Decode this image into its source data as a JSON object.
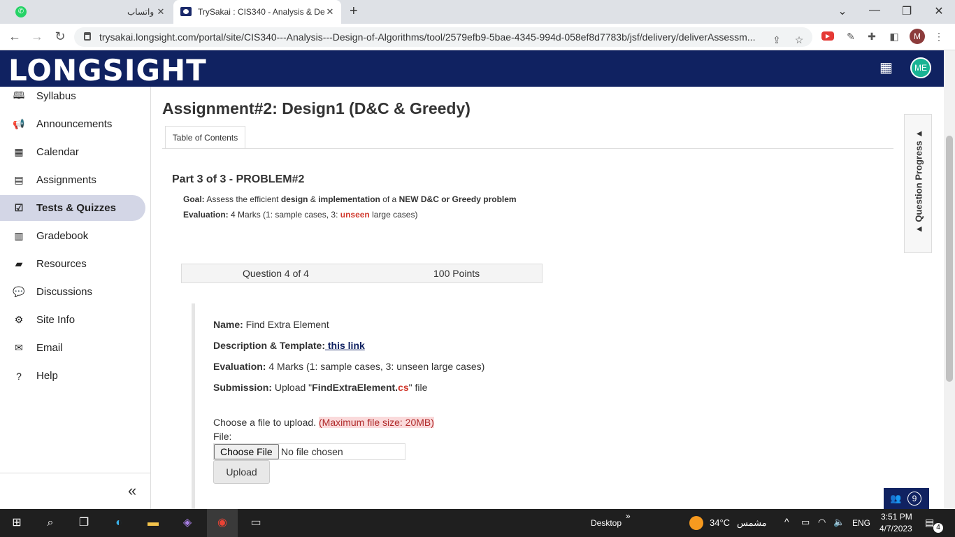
{
  "browser": {
    "tabs": [
      {
        "title": "واتساب",
        "close": "✕"
      },
      {
        "title": "TrySakai : CIS340 - Analysis & De",
        "close": "✕"
      }
    ],
    "new_tab": "+",
    "window_controls": {
      "dropdown": "⌄",
      "minimize": "—",
      "restore": "❐",
      "close": "✕"
    },
    "url": "trysakai.longsight.com/portal/site/CIS340---Analysis---Design-of-Algorithms/tool/2579efb9-5bae-4345-994d-058ef8d7783b/jsf/delivery/deliverAssessm...",
    "profile_initial": "M"
  },
  "header": {
    "logo": "LONGSIGHT",
    "user_initials": "ME"
  },
  "sidebar": {
    "items": [
      {
        "label": "Syllabus",
        "icon": "book-icon"
      },
      {
        "label": "Announcements",
        "icon": "megaphone-icon"
      },
      {
        "label": "Calendar",
        "icon": "calendar-icon"
      },
      {
        "label": "Assignments",
        "icon": "file-icon"
      },
      {
        "label": "Tests & Quizzes",
        "icon": "check-square-icon"
      },
      {
        "label": "Gradebook",
        "icon": "gradebook-icon"
      },
      {
        "label": "Resources",
        "icon": "folder-icon"
      },
      {
        "label": "Discussions",
        "icon": "comments-icon"
      },
      {
        "label": "Site Info",
        "icon": "gear-icon"
      },
      {
        "label": "Email",
        "icon": "envelope-icon"
      },
      {
        "label": "Help",
        "icon": "help-icon"
      }
    ],
    "active_index": 4,
    "collapse": "«"
  },
  "main": {
    "title": "Assignment#2: Design1 (D&C & Greedy)",
    "toc_tab": "Table of Contents",
    "part_title": "Part 3 of 3 - PROBLEM#2",
    "goal": {
      "label": "Goal:",
      "t1": " Assess the efficient ",
      "b1": "design",
      "t2": " & ",
      "b2": "implementation",
      "t3": " of a ",
      "b3": "NEW D&C or Greedy problem"
    },
    "evaluation_part": {
      "label": "Evaluation:",
      "t1": " 4 Marks (1: sample cases, 3: ",
      "red": "unseen",
      "t2": " large cases)"
    },
    "question_number": "Question 4 of 4",
    "points": "100 Points",
    "question": {
      "name_label": "Name:",
      "name_value": " Find Extra Element",
      "desc_label": "Description & Template:",
      "desc_link": " this link",
      "eval_label": "Evaluation:",
      "eval_value": " 4 Marks (1: sample cases, 3: unseen large cases)",
      "sub_label": "Submission:",
      "sub_t1": " Upload \"",
      "sub_file": "FindExtraElement.",
      "sub_ext": "cs",
      "sub_t2": "\" file"
    },
    "upload": {
      "prompt": "Choose a file to upload. ",
      "max_size": "(Maximum file size: 20MB)",
      "file_label": "File:",
      "choose_btn": "Choose File",
      "no_file": "No file chosen",
      "upload_btn": "Upload"
    },
    "question_progress": "▲ Question Progress ▲",
    "presence_count": "9"
  },
  "taskbar": {
    "desktop": "Desktop",
    "chevron": "»",
    "temp": "34°C",
    "weather_word": "مشمس",
    "lang": "ENG",
    "time": "3:51 PM",
    "date": "4/7/2023",
    "notifications": "4"
  }
}
